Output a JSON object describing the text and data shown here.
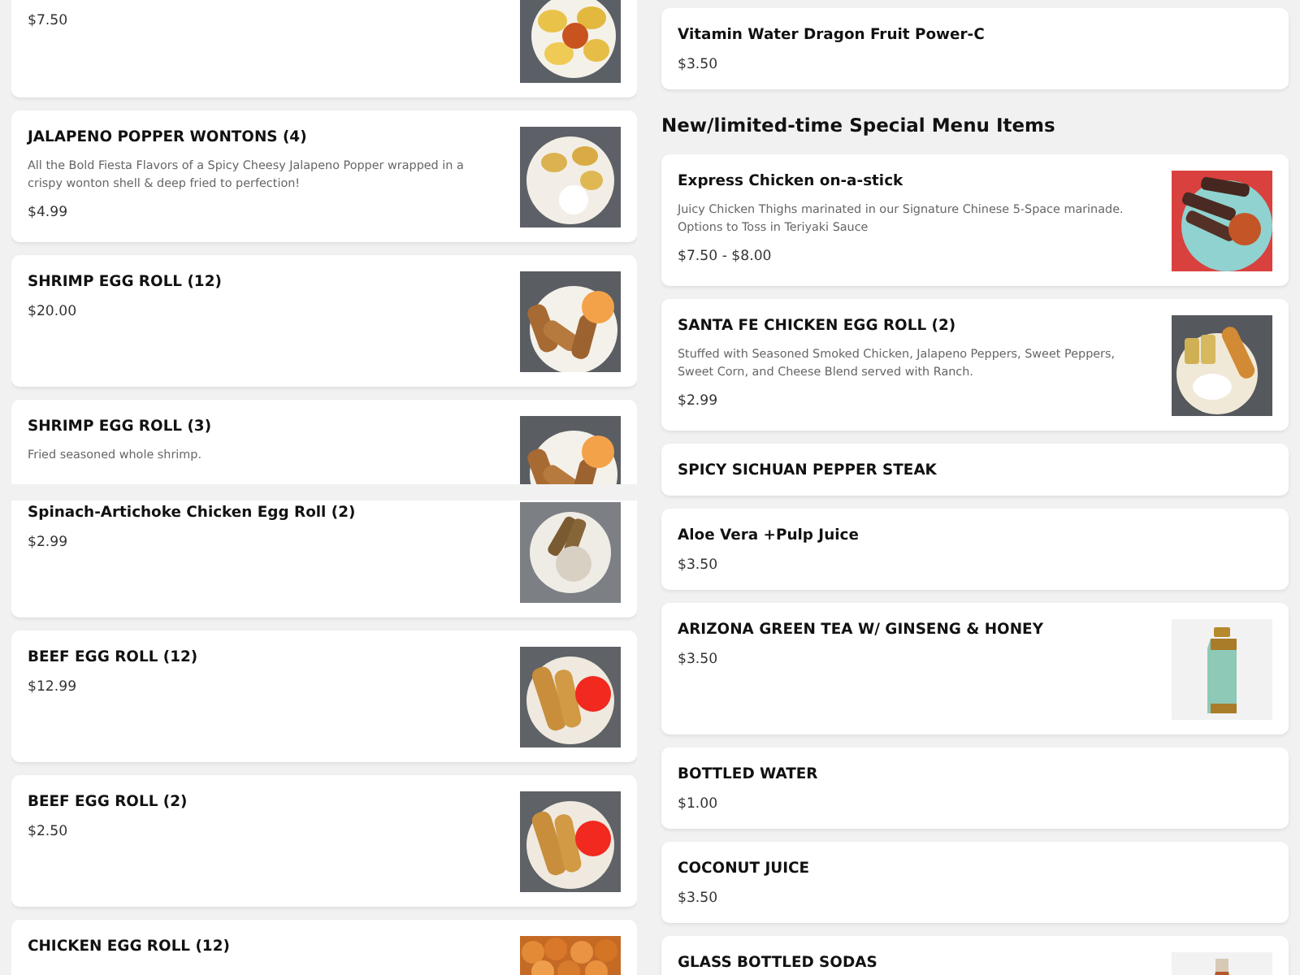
{
  "left_column": {
    "upper_panel": [
      {
        "price": "$7.50"
      },
      {
        "name": "JALAPENO POPPER WONTONS (4)",
        "description": "All the Bold Fiesta Flavors of a Spicy Cheesy Jalapeno Popper wrapped in a crispy wonton shell & deep fried to perfection!",
        "price": "$4.99"
      },
      {
        "name": "SHRIMP EGG ROLL (12)",
        "price": "$20.00"
      },
      {
        "name": "SHRIMP EGG ROLL (3)",
        "description": "Fried seasoned whole shrimp."
      }
    ],
    "lower_panel": [
      {
        "name": "Spinach-Artichoke Chicken Egg Roll (2)",
        "price": "$2.99"
      },
      {
        "name": "BEEF EGG ROLL (12)",
        "price": "$12.99"
      },
      {
        "name": "BEEF EGG ROLL (2)",
        "price": "$2.50"
      },
      {
        "name": "CHICKEN EGG ROLL (12)"
      }
    ]
  },
  "right_column": [
    {
      "kind": "item",
      "name": "Vitamin Water Dragon Fruit Power-C",
      "price": "$3.50"
    },
    {
      "kind": "heading",
      "text": "New/limited-time Special Menu Items"
    },
    {
      "kind": "item",
      "name": "Express Chicken on-a-stick",
      "description": "Juicy Chicken Thighs marinated in our Signature Chinese 5-Space marinade. Options to Toss in Teriyaki Sauce",
      "price": "$7.50 - $8.00"
    },
    {
      "kind": "item",
      "name": "SANTA FE CHICKEN EGG ROLL (2)",
      "description": "Stuffed with Seasoned Smoked Chicken, Jalapeno Peppers, Sweet Peppers, Sweet Corn, and Cheese Blend served with Ranch.",
      "price": "$2.99"
    },
    {
      "kind": "item",
      "name": "SPICY SICHUAN PEPPER STEAK"
    },
    {
      "kind": "item",
      "name": "Aloe Vera +Pulp Juice",
      "price": "$3.50"
    },
    {
      "kind": "item",
      "name": "ARIZONA GREEN TEA W/ GINSENG & HONEY",
      "price": "$3.50"
    },
    {
      "kind": "item",
      "name": "BOTTLED WATER",
      "price": "$1.00"
    },
    {
      "kind": "item",
      "name": "COCONUT JUICE",
      "price": "$3.50"
    },
    {
      "kind": "item",
      "name": "GLASS BOTTLED SODAS"
    }
  ]
}
